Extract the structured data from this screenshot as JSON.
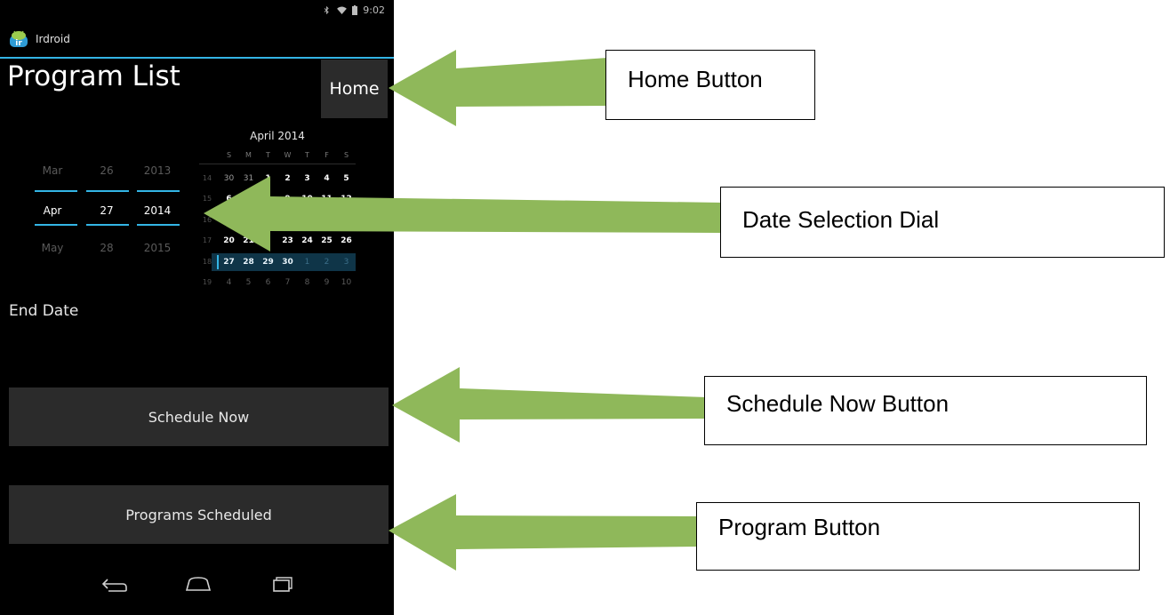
{
  "status_bar": {
    "time": "9:02"
  },
  "app": {
    "name": "Irdroid",
    "icon_text": "ir"
  },
  "page": {
    "title": "Program List"
  },
  "buttons": {
    "home": "Home",
    "schedule_now": "Schedule Now",
    "programs_scheduled": "Programs Scheduled"
  },
  "date_spinner": {
    "above": {
      "month": "Mar",
      "day": "26",
      "year": "2013"
    },
    "selected": {
      "month": "Apr",
      "day": "27",
      "year": "2014"
    },
    "below": {
      "month": "May",
      "day": "28",
      "year": "2015"
    }
  },
  "calendar": {
    "title": "April 2014",
    "weekdays": [
      "S",
      "M",
      "T",
      "W",
      "T",
      "F",
      "S"
    ],
    "weeks": [
      {
        "week": "14",
        "days": [
          "30",
          "31",
          "1",
          "2",
          "3",
          "4",
          "5"
        ]
      },
      {
        "week": "15",
        "days": [
          "6",
          "",
          "",
          "9",
          "10",
          "11",
          "12"
        ]
      },
      {
        "week": "16",
        "days": [
          "",
          "",
          "",
          "",
          "",
          "",
          ""
        ]
      },
      {
        "week": "17",
        "days": [
          "20",
          "21",
          "",
          "23",
          "24",
          "25",
          "26"
        ]
      },
      {
        "week": "18",
        "days": [
          "27",
          "28",
          "29",
          "30",
          "1",
          "2",
          "3"
        ]
      },
      {
        "week": "19",
        "days": [
          "4",
          "5",
          "6",
          "7",
          "8",
          "9",
          "10"
        ]
      }
    ]
  },
  "labels": {
    "end_date": "End Date"
  },
  "navigation": {
    "back": "back-icon",
    "home": "home-icon",
    "recents": "recents-icon"
  },
  "annotations": {
    "home_button": "Home Button",
    "date_selection_dial": "Date Selection Dial",
    "schedule_now_button": "Schedule Now Button",
    "program_button": "Program Button"
  },
  "colors": {
    "accent": "#33b5e5",
    "arrow": "#8fb85a",
    "button_bg": "#2b2b2b"
  }
}
